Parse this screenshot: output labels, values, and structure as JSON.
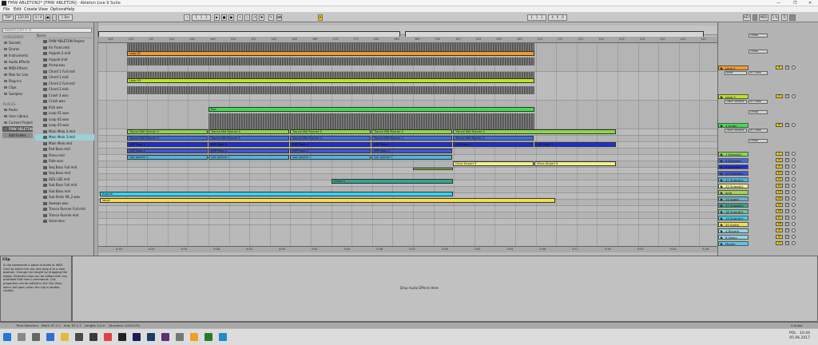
{
  "window": {
    "title": "FMW ABLETON2* [FMW ABLETON] - Ableton Live 9 Suite",
    "controls": [
      "—",
      "❐",
      "✕"
    ]
  },
  "menu": [
    "File",
    "Edit",
    "Create",
    "View",
    "Options",
    "Help"
  ],
  "control_bar": {
    "tap": "TAP",
    "tempo": "120.00",
    "signature": "4 / 4",
    "quantize": "1 Bar",
    "position": "1 . 1 . 1",
    "loop_start": "1 . 1 . 1",
    "loop_length": "4 . 0 . 0",
    "key": "KEY",
    "midi": "MIDI",
    "cpu": "3 %"
  },
  "browser": {
    "search_placeholder": "Search (Ctrl + F)",
    "categories_header": "CATEGORIES",
    "categories": [
      "Sounds",
      "Drums",
      "Instruments",
      "Audio Effects",
      "MIDI Effects",
      "Max for Live",
      "Plug-ins",
      "Clips",
      "Samples"
    ],
    "places_header": "PLACES",
    "places": [
      "Packs",
      "User Library",
      "Current Project",
      "FMW ABLETON",
      "Add Folder..."
    ],
    "name_header": "Name",
    "files": [
      "FMW ABLETON Project",
      "Air Front.mid",
      "Arpjute 2.mid",
      "Arpjute.mid",
      "Arrow.wav",
      "Chord 1 Full.mid",
      "Chord 1.mid",
      "Chord 2 Full.mid",
      "Chord 2.mid",
      "Crash 3.wav",
      "Crash.wav",
      "Kick.wav",
      "Loop 01.wav",
      "Loop 02.wav",
      "Loop 03.wav",
      "Main Melo 2.mid",
      "Main Melo 3.mid",
      "Main Melo.mid",
      "Pad Bass.mid",
      "Piano.mid",
      "Ride.wav",
      "Seq Bass Full.mid",
      "Seq Bass.mid",
      "SEQ LSD.mid",
      "Sub Bass Full.mid",
      "Sub Bass.mid",
      "Sub Kicks 08_2.wav",
      "Sweeps.wav",
      "Trance Runner Full.mid",
      "Trance Runner.mid",
      "Vocal.wav"
    ],
    "selected_file": "Main Melo 3.mid"
  },
  "clip_info": {
    "title": "Clip",
    "body": "A clip represents a piece of audio or MIDI. Click to select the clip and drag it to a new position. Change clip length by dragging the edges. Selected clips can be edited with any available Edit menu commands. Clip properties can be edited in the Clip View, which will open when the clip is double-clicked."
  },
  "ruler": [
    "129",
    "133",
    "137",
    "141",
    "145",
    "149",
    "153",
    "157",
    "161",
    "165",
    "169",
    "173",
    "177",
    "181",
    "185",
    "189",
    "193",
    "197",
    "201",
    "205",
    "209",
    "213",
    "217",
    "221",
    "225",
    "229",
    "233",
    "237",
    "241",
    "245"
  ],
  "timeline": [
    "4:16",
    "4:20",
    "4:24",
    "4:28",
    "4:32",
    "4:36",
    "4:40",
    "4:44",
    "4:48",
    "4:52",
    "4:56",
    "5:00",
    "5:04",
    "5:08",
    "5:12",
    "5:16",
    "5:20",
    "5:24",
    "5:28"
  ],
  "clips": [
    {
      "label": "Loop 02",
      "color": "#f59a2a"
    },
    {
      "label": "Loop 03",
      "color": "#b7e51c"
    },
    {
      "label": "Pad",
      "color": "#3ee04a"
    },
    {
      "label": "Trance Mid Runner 4",
      "color": "#8ad84a"
    },
    {
      "label": "Trance Mid Runner 3",
      "color": "#3b6fe0"
    },
    {
      "label": "ARP Bass 1",
      "color": "#1b2ed8"
    },
    {
      "label": "ARP Bass 2",
      "color": "#3f57d8"
    },
    {
      "label": "sub pointer 1",
      "color": "#46b6e6"
    },
    {
      "label": "Drive Airport 6",
      "color": "#f3f08a"
    },
    {
      "label": "Chord 1",
      "color": "#35a48e"
    },
    {
      "label": "Arpjute",
      "color": "#38d0ef"
    },
    {
      "label": "Vocal",
      "color": "#f2e04a"
    },
    {
      "label": "Trance Mid Runner 2",
      "color": "#4f77e0"
    },
    {
      "label": "Trance Mid Runner 1",
      "color": "#5f9be0"
    },
    {
      "label": "Pad Bass",
      "color": "#6f8fe0"
    }
  ],
  "tracks": [
    {
      "name": "Loop 2",
      "color": "#f59a2a",
      "num": "4",
      "extra": "Mute"
    },
    {
      "name": "Loop 3",
      "color": "#b7e51c",
      "num": "5",
      "extra": "Track Volume"
    },
    {
      "name": "4 Audio",
      "color": "#3ee04a",
      "num": "6",
      "extra": "Track Volume"
    },
    {
      "name": "7 Sylenth1",
      "color": "#8ad84a",
      "num": "7",
      "extra": ""
    },
    {
      "name": "8 Sylenth1",
      "color": "#3b6fe0",
      "num": "8",
      "extra": ""
    },
    {
      "name": "9 Sylenth1",
      "color": "#1b2ed8",
      "num": "9",
      "extra": ""
    },
    {
      "name": "10 Sylenth1",
      "color": "#3f57d8",
      "num": "10",
      "extra": ""
    },
    {
      "name": "11 Sylenth1",
      "color": "#46b6e6",
      "num": "11",
      "extra": ""
    },
    {
      "name": "12 Sylenth1",
      "color": "#f3f08a",
      "num": "12",
      "extra": ""
    },
    {
      "name": "Acid",
      "color": "#9ed84a",
      "num": "13",
      "extra": ""
    },
    {
      "name": "14 Audio",
      "color": "#5fb8c8",
      "num": "14",
      "extra": ""
    },
    {
      "name": "17 Sylenth1",
      "color": "#35a48e",
      "num": "15",
      "extra": ""
    },
    {
      "name": "18 Sylenth1",
      "color": "#5fc8a8",
      "num": "16",
      "extra": ""
    },
    {
      "name": "19 Sylenth1",
      "color": "#38d0ef",
      "num": "17",
      "extra": ""
    },
    {
      "name": "20 Audio",
      "color": "#f2e04a",
      "num": "18",
      "extra": ""
    },
    {
      "name": "A Reverb",
      "color": "#8fd6e8",
      "num": "A",
      "extra": ""
    },
    {
      "name": "B Delay",
      "color": "#8fd6e8",
      "num": "B",
      "extra": ""
    },
    {
      "name": "Master",
      "color": "#58c8e8",
      "num": "0",
      "extra": ""
    }
  ],
  "mixer_labels": {
    "group": "Group",
    "inout": "In Chain",
    "post": "Post",
    "all_ins": "All Ins"
  },
  "bottom": {
    "drop_text": "Drop Audio Effects Here"
  },
  "status": {
    "selection": "Time Selection",
    "start": "Start: 97.1.1",
    "end": "End: 97.1.1",
    "length": "Length: 0.0.0",
    "duration": "(Duration: 0:00:479)",
    "device": "4 Audio"
  },
  "tray": {
    "time": "10:44",
    "date": "05.06.2017",
    "lang": "POL"
  }
}
